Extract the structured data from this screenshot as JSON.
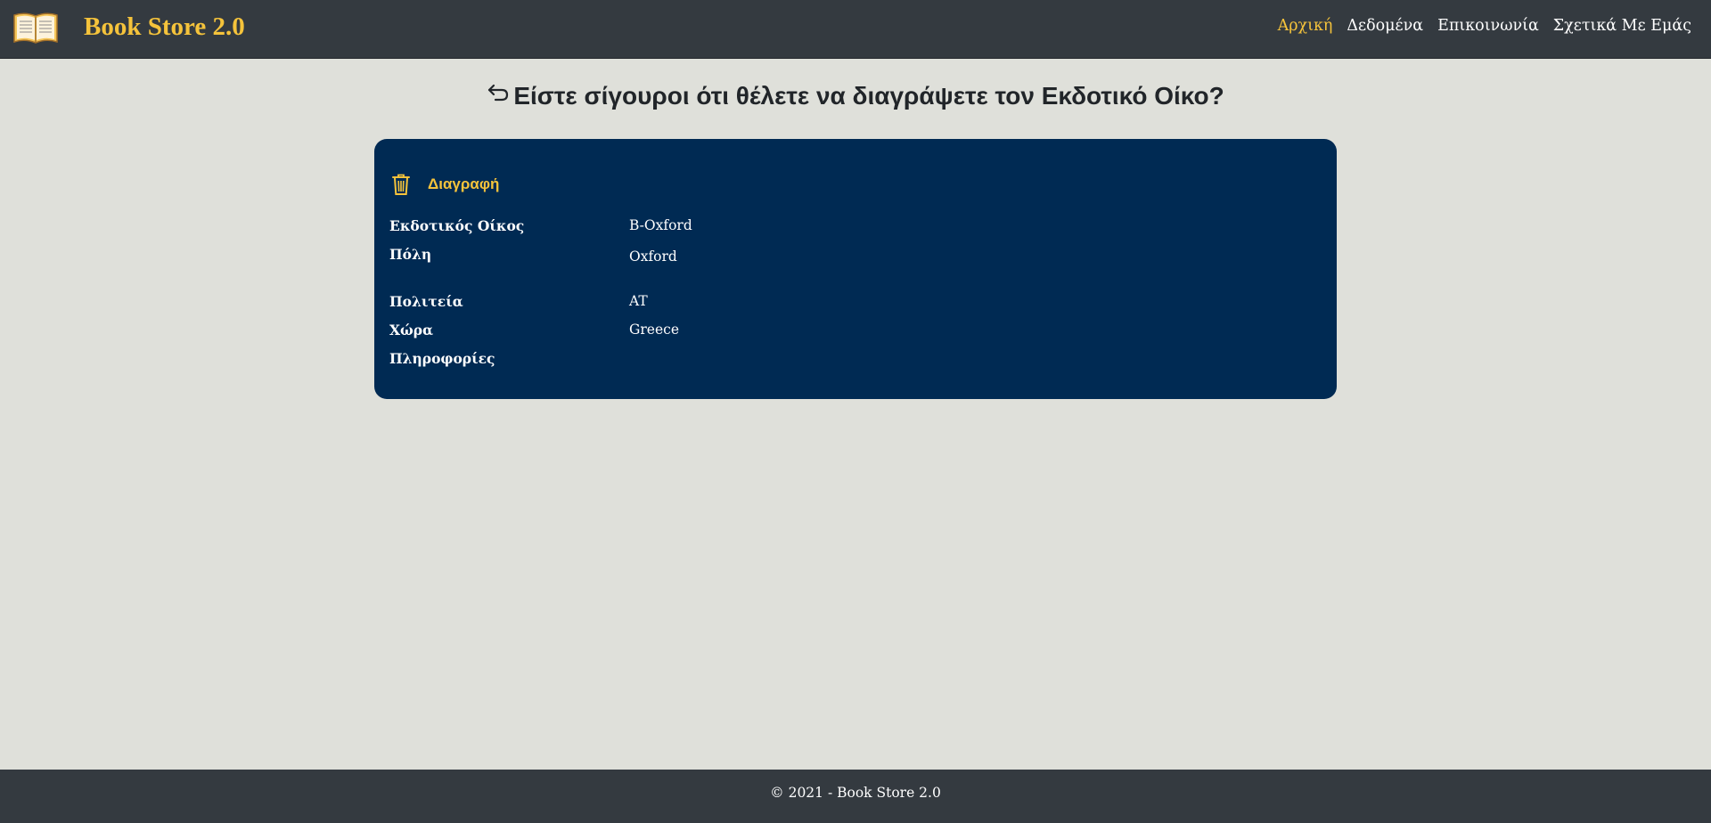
{
  "header": {
    "brand": "Book Store 2.0",
    "logo_icon": "open-book-icon",
    "nav": [
      {
        "label": "Αρχική",
        "active": true
      },
      {
        "label": "Δεδομένα",
        "active": false
      },
      {
        "label": "Επικοινωνία",
        "active": false
      },
      {
        "label": "Σχετικά Με Εμάς",
        "active": false
      }
    ]
  },
  "heading": {
    "back_icon": "back-arrow-icon",
    "text": "Είστε σίγουροι ότι θέλετε να διαγράψετε τον Εκδοτικό Οίκο?"
  },
  "card": {
    "delete": {
      "icon": "trash-icon",
      "label": "Διαγραφή"
    },
    "fields": [
      {
        "label": "Εκδοτικός Οίκος",
        "value": "B-Oxford"
      },
      {
        "label": "Πόλη",
        "value": "Oxford"
      },
      {
        "label": "Πολιτεία",
        "value": "AT"
      },
      {
        "label": "Χώρα",
        "value": "Greece"
      },
      {
        "label": "Πληροφορίες",
        "value": ""
      }
    ]
  },
  "footer": {
    "text": "© 2021 - Book Store 2.0"
  },
  "colors": {
    "navbar": "#343a40",
    "accent": "#f5c33b",
    "card": "#002a53",
    "background": "#dfe0da"
  }
}
